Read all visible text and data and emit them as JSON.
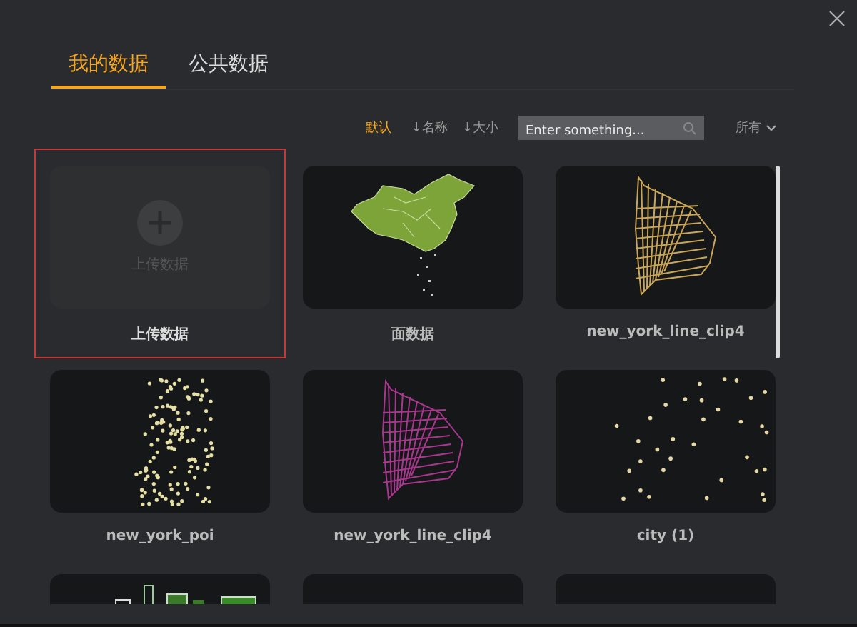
{
  "tabs": [
    {
      "label": "我的数据",
      "selected": true
    },
    {
      "label": "公共数据",
      "selected": false
    }
  ],
  "sort_options": [
    {
      "label": "默认",
      "selected": true
    },
    {
      "label": "↓名称",
      "selected": false
    },
    {
      "label": "↓大小",
      "selected": false
    }
  ],
  "search": {
    "placeholder": "Enter something..."
  },
  "filter": {
    "label": "所有"
  },
  "items": [
    {
      "kind": "upload",
      "button_text": "上传数据",
      "label": "上传数据",
      "selected": true
    },
    {
      "kind": "dataset",
      "label": "面数据",
      "selected": false
    },
    {
      "kind": "dataset",
      "label": "new_york_line_clip4",
      "selected": false
    },
    {
      "kind": "dataset",
      "label": "new_york_poi",
      "selected": false
    },
    {
      "kind": "dataset",
      "label": "new_york_line_clip4",
      "selected": false
    },
    {
      "kind": "dataset",
      "label": "city (1)",
      "selected": false
    },
    {
      "kind": "dataset",
      "selected": false
    },
    {
      "kind": "dataset",
      "selected": false
    },
    {
      "kind": "dataset",
      "selected": false
    }
  ]
}
